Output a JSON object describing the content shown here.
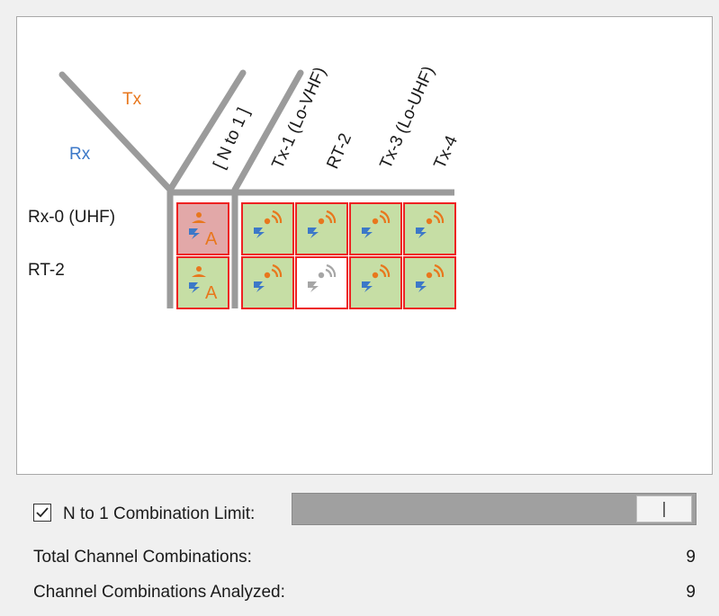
{
  "matrix": {
    "tx_axis_label": "Tx",
    "rx_axis_label": "Rx",
    "n_to_1_column_label": "[ N to 1 ]",
    "columns": [
      {
        "label": "Tx-1 (Lo-VHF)"
      },
      {
        "label": "RT-2"
      },
      {
        "label": "Tx-3 (Lo-UHF)"
      },
      {
        "label": "Tx-4"
      }
    ],
    "rows": [
      {
        "label": "Rx-0 (UHF)",
        "n_to_1_cell": {
          "state": "highlighted",
          "glyph": "A"
        },
        "cells": [
          "analyzed",
          "analyzed",
          "analyzed",
          "analyzed"
        ]
      },
      {
        "label": "RT-2",
        "n_to_1_cell": {
          "state": "analyzed",
          "glyph": "A"
        },
        "cells": [
          "analyzed",
          "self",
          "analyzed",
          "analyzed"
        ]
      }
    ],
    "colors": {
      "tx": "#e8771d",
      "rx": "#3c78c8",
      "cell_green": "#c6dea5",
      "cell_highlight": "#e2a8a8",
      "cell_border": "#ee2222",
      "divider": "#9b9b9b",
      "inactive_icon": "#a6a6a6"
    }
  },
  "controls": {
    "n_to_1_limit_label": "N to 1 Combination Limit:",
    "n_to_1_limit_checked": true,
    "n_to_1_limit_slider_fraction": 1.0
  },
  "stats": {
    "total_label": "Total Channel Combinations:",
    "total_value": "9",
    "analyzed_label": "Channel Combinations Analyzed:",
    "analyzed_value": "9"
  }
}
